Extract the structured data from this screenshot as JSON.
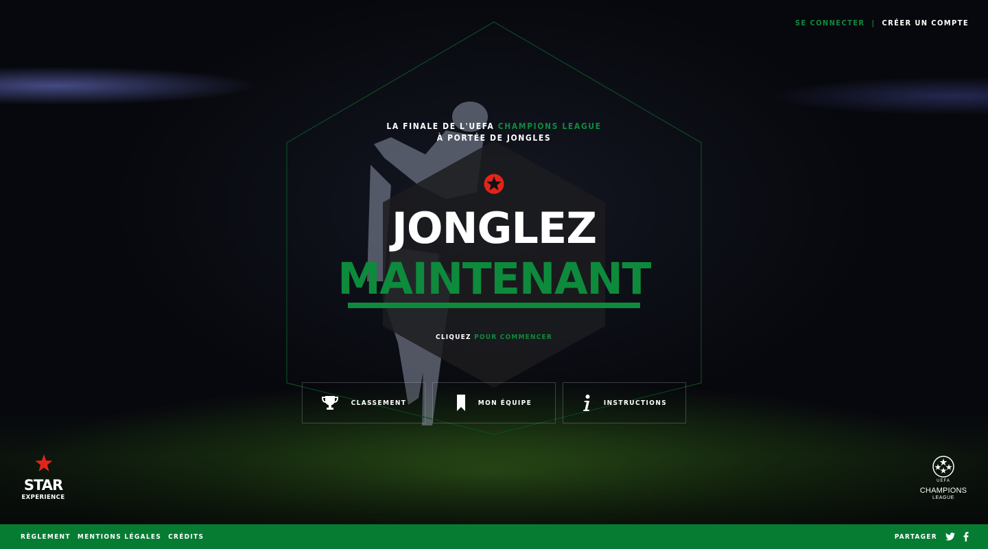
{
  "top_nav": {
    "login_label": "SE CONNECTER",
    "separator": "|",
    "signup_label": "CRÉER UN COMPTE"
  },
  "hero": {
    "tagline_line1_prefix": "LA FINALE DE L'UEFA",
    "tagline_line1_accent": "CHAMPIONS LEAGUE",
    "tagline_line2": "À PORTÉE DE JONGLES",
    "title": "JONGLEZ",
    "subtitle": "MAINTENANT",
    "cta_prefix": "CLIQUEZ",
    "cta_accent": "POUR COMMENCER"
  },
  "actions": [
    {
      "label": "CLASSEMENT",
      "icon": "trophy-icon"
    },
    {
      "label": "MON ÉQUIPE",
      "icon": "bookmark-icon"
    },
    {
      "label": "INSTRUCTIONS",
      "icon": "info-icon"
    }
  ],
  "logos": {
    "left_wordmark": "STAR",
    "left_sub": "EXPERIENCE",
    "right_line1": "UEFA",
    "right_line2": "CHAMPIONS",
    "right_line3": "LEAGUE"
  },
  "footer": {
    "links": [
      "RÈGLEMENT",
      "MENTIONS LÉGALES",
      "CRÉDITS"
    ],
    "share_label": "PARTAGER",
    "share_icons": [
      "twitter-icon",
      "facebook-icon"
    ]
  },
  "colors": {
    "accent_green": "#0e8a3c",
    "footer_green": "#067c33",
    "star_red": "#e1251b"
  }
}
